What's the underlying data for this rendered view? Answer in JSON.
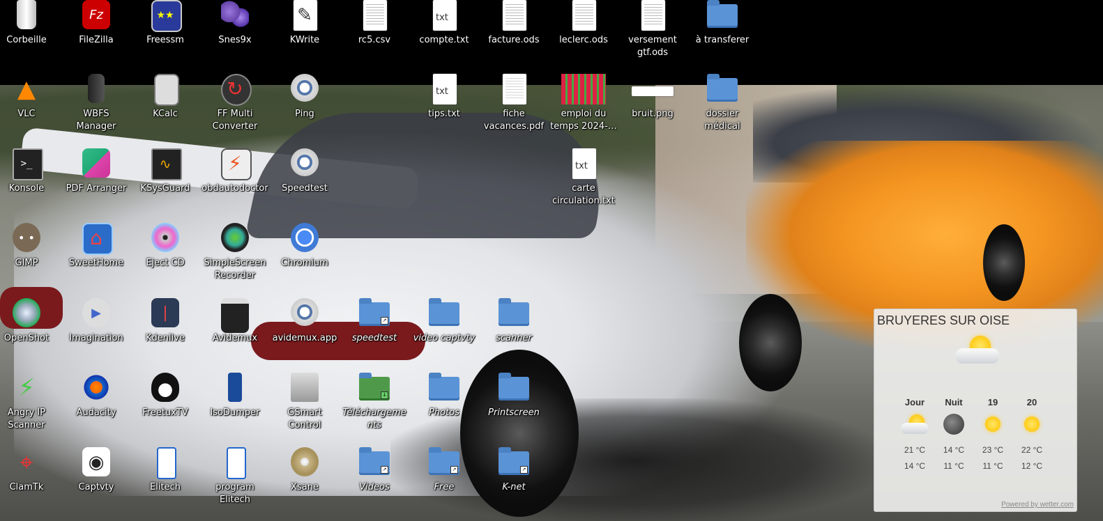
{
  "desktop": {
    "icons": [
      {
        "id": "corbeille",
        "label": "Corbeille",
        "kind": "trash",
        "italic": false
      },
      {
        "id": "filezilla",
        "label": "FileZilla",
        "kind": "filezilla",
        "italic": false
      },
      {
        "id": "freessm",
        "label": "Freessm",
        "kind": "freessm",
        "italic": false
      },
      {
        "id": "snes9x",
        "label": "Snes9x",
        "kind": "snes",
        "italic": false
      },
      {
        "id": "kwrite",
        "label": "KWrite",
        "kind": "kwrite",
        "italic": false
      },
      {
        "id": "rc5-csv",
        "label": "rc5.csv",
        "kind": "spreadsheet",
        "italic": false
      },
      {
        "id": "compte-txt",
        "label": "compte.txt",
        "kind": "txt",
        "italic": false
      },
      {
        "id": "facture-ods",
        "label": "facture.ods",
        "kind": "spreadsheet",
        "italic": false
      },
      {
        "id": "leclerc-ods",
        "label": "leclerc.ods",
        "kind": "spreadsheet",
        "italic": false
      },
      {
        "id": "versement-gtf-ods",
        "label": "versement gtf.ods",
        "kind": "spreadsheet",
        "italic": false
      },
      {
        "id": "a-transferer",
        "label": "à transferer",
        "kind": "folder",
        "italic": false
      },
      {
        "id": "vlc",
        "label": "VLC",
        "kind": "vlc",
        "italic": false
      },
      {
        "id": "wbfs-manager",
        "label": "WBFS Manager",
        "kind": "wbfs",
        "italic": false
      },
      {
        "id": "kcalc",
        "label": "KCalc",
        "kind": "kcalc",
        "italic": false
      },
      {
        "id": "ff-multi-converter",
        "label": "FF Multi Converter",
        "kind": "ffmc",
        "italic": false
      },
      {
        "id": "ping",
        "label": "Ping",
        "kind": "gear",
        "italic": false
      },
      {
        "id": "tips-txt",
        "label": "tips.txt",
        "kind": "txt",
        "italic": false
      },
      {
        "id": "fiche-vacances-pdf",
        "label": "fiche vacances.pdf",
        "kind": "pdf",
        "italic": false
      },
      {
        "id": "emploi-du-temps",
        "label": "emploi du temps 2024-…",
        "kind": "grid-image",
        "italic": false
      },
      {
        "id": "bruit-png",
        "label": "bruit.png",
        "kind": "png",
        "italic": false
      },
      {
        "id": "dossier-medical",
        "label": "dossier médical",
        "kind": "folder",
        "italic": false
      },
      {
        "id": "konsole",
        "label": "Konsole",
        "kind": "konsole",
        "italic": false
      },
      {
        "id": "pdf-arranger",
        "label": "PDF Arranger",
        "kind": "pdfarranger",
        "italic": false
      },
      {
        "id": "ksysguard",
        "label": "KSysGuard",
        "kind": "ksysguard",
        "italic": false
      },
      {
        "id": "obdautodoctor",
        "label": "obdautodoctor",
        "kind": "obd",
        "italic": false
      },
      {
        "id": "speedtest-app",
        "label": "Speedtest",
        "kind": "gear",
        "italic": false
      },
      {
        "id": "carte-circulation-txt",
        "label": "carte circulation.txt",
        "kind": "txt",
        "italic": false
      },
      {
        "id": "gimp",
        "label": "GIMP",
        "kind": "gimp",
        "italic": false
      },
      {
        "id": "sweethome",
        "label": "SweetHome",
        "kind": "sweethome",
        "italic": false
      },
      {
        "id": "eject-cd",
        "label": "Eject CD",
        "kind": "cd",
        "italic": false
      },
      {
        "id": "simplescreenrecorder",
        "label": "SimpleScreen Recorder",
        "kind": "ssr",
        "italic": false
      },
      {
        "id": "chromium",
        "label": "Chromium",
        "kind": "chromium",
        "italic": false
      },
      {
        "id": "openshot",
        "label": "OpenShot",
        "kind": "openshot",
        "italic": false
      },
      {
        "id": "imagination",
        "label": "Imagination",
        "kind": "imagination",
        "italic": false
      },
      {
        "id": "kdenlive",
        "label": "Kdenlive",
        "kind": "kdenlive",
        "italic": false
      },
      {
        "id": "avidemux",
        "label": "Avidemux",
        "kind": "clapper",
        "italic": false
      },
      {
        "id": "avidemux-app",
        "label": "avidemux.app",
        "kind": "gear",
        "italic": false
      },
      {
        "id": "speedtest-link",
        "label": "speedtest",
        "kind": "folder-link",
        "italic": true
      },
      {
        "id": "video-captvty",
        "label": "video captvty",
        "kind": "folder",
        "italic": true
      },
      {
        "id": "scanner",
        "label": "scanner",
        "kind": "folder",
        "italic": true
      },
      {
        "id": "angry-ip-scanner",
        "label": "Angry IP Scanner",
        "kind": "angryip",
        "italic": false
      },
      {
        "id": "audacity",
        "label": "Audacity",
        "kind": "audacity",
        "italic": false
      },
      {
        "id": "freetuxtv",
        "label": "FreetuxTV",
        "kind": "tux",
        "italic": false
      },
      {
        "id": "isodumper",
        "label": "IsoDumper",
        "kind": "usb",
        "italic": false
      },
      {
        "id": "gsmart-control",
        "label": "GSmart Control",
        "kind": "hdd",
        "italic": false
      },
      {
        "id": "telechargements",
        "label": "Téléchargements",
        "kind": "folder-download",
        "italic": true
      },
      {
        "id": "photos",
        "label": "Photos",
        "kind": "folder",
        "italic": true
      },
      {
        "id": "printscreen",
        "label": "Printscreen",
        "kind": "folder",
        "italic": true
      },
      {
        "id": "clamtk",
        "label": "ClamTk",
        "kind": "clamtk",
        "italic": false
      },
      {
        "id": "captvty",
        "label": "Captvty",
        "kind": "captvty",
        "italic": false
      },
      {
        "id": "elitech",
        "label": "Elitech",
        "kind": "elitech",
        "italic": false
      },
      {
        "id": "program-elitech",
        "label": "program Elitech",
        "kind": "elitech",
        "italic": false
      },
      {
        "id": "xsane",
        "label": "Xsane",
        "kind": "xsane",
        "italic": false
      },
      {
        "id": "videos",
        "label": "Videos",
        "kind": "folder-link",
        "italic": true
      },
      {
        "id": "free",
        "label": "Free",
        "kind": "folder-link",
        "italic": true
      },
      {
        "id": "k-net",
        "label": "K-net",
        "kind": "folder-link",
        "italic": true
      }
    ]
  },
  "weather": {
    "city": "BRUYERES SUR OISE",
    "current_icon": "sun-cloud-icon",
    "columns": [
      {
        "label": "Jour",
        "icon": "sun-cloud-icon",
        "high": "21 °C",
        "low": "14 °C"
      },
      {
        "label": "Nuit",
        "icon": "moon-icon",
        "high": "14 °C",
        "low": "11 °C"
      },
      {
        "label": "19",
        "icon": "sun-icon",
        "high": "23 °C",
        "low": "11 °C"
      },
      {
        "label": "20",
        "icon": "sun-icon",
        "high": "22 °C",
        "low": "12 °C"
      }
    ],
    "powered_by": "Powered by wetter.com"
  },
  "colors": {
    "folder": "#5a93d6",
    "weather_panel": "#eeeeec",
    "label_text": "#ffffff"
  }
}
